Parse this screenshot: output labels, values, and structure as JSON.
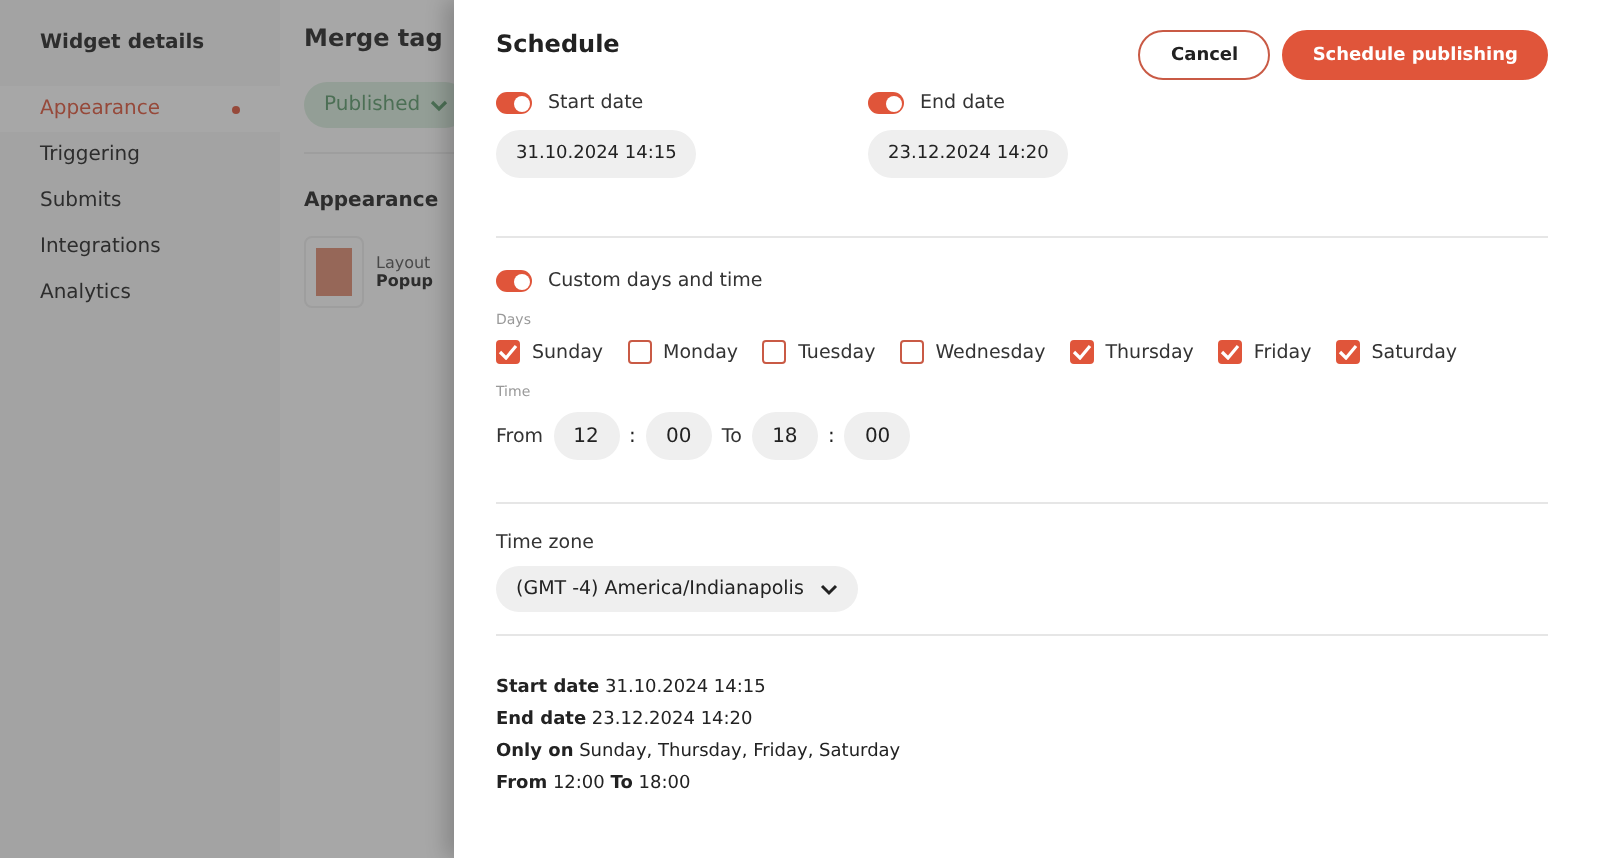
{
  "sidebar": {
    "title": "Widget details",
    "items": [
      {
        "label": "Appearance",
        "selected": true
      },
      {
        "label": "Triggering",
        "selected": false
      },
      {
        "label": "Submits",
        "selected": false
      },
      {
        "label": "Integrations",
        "selected": false
      },
      {
        "label": "Analytics",
        "selected": false
      }
    ]
  },
  "main": {
    "title": "Merge tag",
    "status": "Published",
    "section": "Appearance",
    "layout_label": "Layout",
    "layout_value": "Popup"
  },
  "drawer": {
    "title": "Schedule",
    "buttons": {
      "cancel": "Cancel",
      "confirm": "Schedule publishing"
    },
    "dates": [
      {
        "label": "Start date",
        "on": true,
        "value": "31.10.2024 14:15"
      },
      {
        "label": "End date",
        "on": true,
        "value": "23.12.2024 14:20"
      }
    ],
    "custom": {
      "label": "Custom days and time",
      "on": true
    },
    "days_label": "Days",
    "days": [
      {
        "label": "Sunday",
        "checked": true
      },
      {
        "label": "Monday",
        "checked": false
      },
      {
        "label": "Tuesday",
        "checked": false
      },
      {
        "label": "Wednesday",
        "checked": false
      },
      {
        "label": "Thursday",
        "checked": true
      },
      {
        "label": "Friday",
        "checked": true
      },
      {
        "label": "Saturday",
        "checked": true
      }
    ],
    "time_label": "Time",
    "time": {
      "from_label": "From",
      "from_hour": "12",
      "from_min": "00",
      "sep1": ":",
      "to_label": "To",
      "to_hour": "18",
      "to_min": "00",
      "sep2": ":"
    },
    "timezone": {
      "label": "Time zone",
      "value": "(GMT -4) America/Indianapolis"
    },
    "summary": [
      "**Start date** 31.10.2024 14:15",
      "**End date** 23.12.2024 14:20",
      "**Only on** Sunday, Thursday, Friday, Saturday",
      "**From** 12:00 **To** 18:00"
    ]
  }
}
